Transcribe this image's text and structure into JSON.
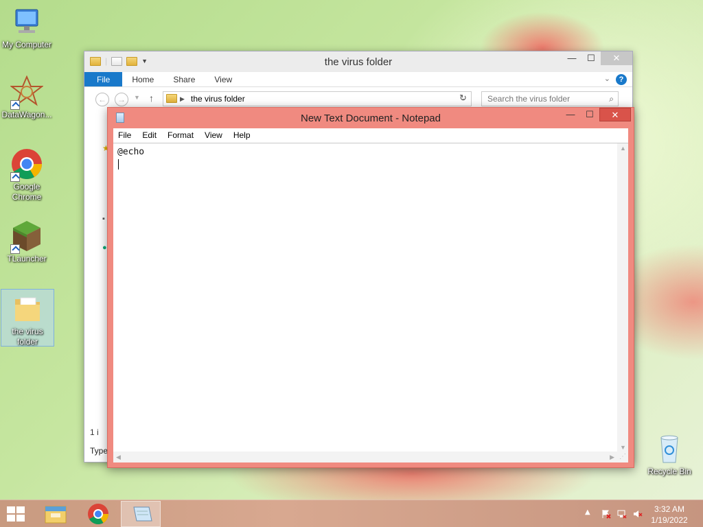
{
  "desktop": {
    "icons": [
      {
        "label": "My Computer"
      },
      {
        "label": "DataWagon..."
      },
      {
        "label": "Google Chrome"
      },
      {
        "label": "TLauncher"
      },
      {
        "label": "the virus folder"
      },
      {
        "label": "Recycle Bin"
      }
    ]
  },
  "explorer": {
    "title": "the virus folder",
    "tabs": [
      "File",
      "Home",
      "Share",
      "View"
    ],
    "address": "the virus folder",
    "search_placeholder": "Search the virus folder",
    "status": "1 i",
    "column_header": "Type"
  },
  "notepad": {
    "title": "New Text Document - Notepad",
    "menu": [
      "File",
      "Edit",
      "Format",
      "View",
      "Help"
    ],
    "content": "@echo"
  },
  "taskbar": {
    "time": "3:32 AM",
    "date": "1/19/2022"
  },
  "colors": {
    "notepad_frame": "#f08a80",
    "explorer_accent": "#1979ca",
    "close_button": "#d9534a"
  }
}
